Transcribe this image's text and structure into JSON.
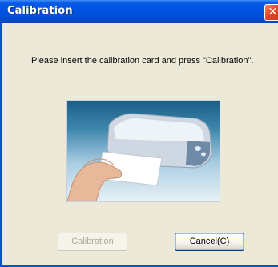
{
  "window": {
    "title": "Calibration",
    "close_glyph": "✕"
  },
  "dialog": {
    "message": "Please insert the calibration card and press \"Calibration\".",
    "illustration_icon": "scanner-with-card-illustration"
  },
  "buttons": {
    "calibration_label": "Calibration",
    "cancel_label": "Cancel(C)"
  },
  "colors": {
    "titlebar": "#0054e3",
    "dialog_bg": "#ece9d8",
    "close_button": "#e04a24"
  }
}
